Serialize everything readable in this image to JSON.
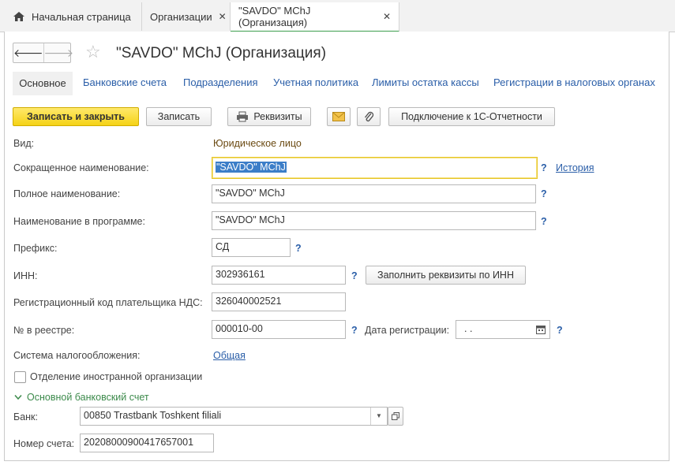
{
  "tabs": [
    {
      "label": "Начальная страница",
      "icon": "home-icon"
    },
    {
      "label": "Организации",
      "close": "✕"
    },
    {
      "label": "\"SAVDO\" MChJ (Организация)",
      "close": "✕"
    }
  ],
  "nav": {
    "back": "🡐",
    "forward": "🡒"
  },
  "form_title": "\"SAVDO\" MChJ (Организация)",
  "sections": [
    "Основное",
    "Банковские счета",
    "Подразделения",
    "Учетная политика",
    "Лимиты остатка кассы",
    "Регистрации в налоговых органах"
  ],
  "toolbar": {
    "save_close": "Записать и закрыть",
    "save": "Записать",
    "requisites": "Реквизиты",
    "connect": "Подключение к 1С-Отчетности"
  },
  "fields": {
    "kind_label": "Вид:",
    "kind_value": "Юридическое лицо",
    "short_label": "Сокращенное наименование:",
    "short_value": "\"SAVDO\" MChJ",
    "history": "История",
    "full_label": "Полное наименование:",
    "full_value": "\"SAVDO\" MChJ",
    "prog_label": "Наименование в программе:",
    "prog_value": "\"SAVDO\" MChJ",
    "prefix_label": "Префикс:",
    "prefix_value": "СД",
    "inn_label": "ИНН:",
    "inn_value": "302936161",
    "fill_inn": "Заполнить реквизиты по ИНН",
    "vat_label": "Регистрационный код плательщика НДС:",
    "vat_value": "326040002521",
    "reg_no_label": "№ в реестре:",
    "reg_no_value": "000010-00",
    "reg_date_label": "Дата регистрации:",
    "reg_date_value": " .  .",
    "tax_label": "Система налогообложения:",
    "tax_value": "Общая",
    "foreign_label": "Отделение иностранной организации",
    "bank_group": "Основной банковский счет",
    "bank_label": "Банк:",
    "bank_value": "00850 Trastbank Toshkent filiali",
    "acct_label": "Номер счета:",
    "acct_value": "20208000900417657001",
    "help": "?"
  }
}
